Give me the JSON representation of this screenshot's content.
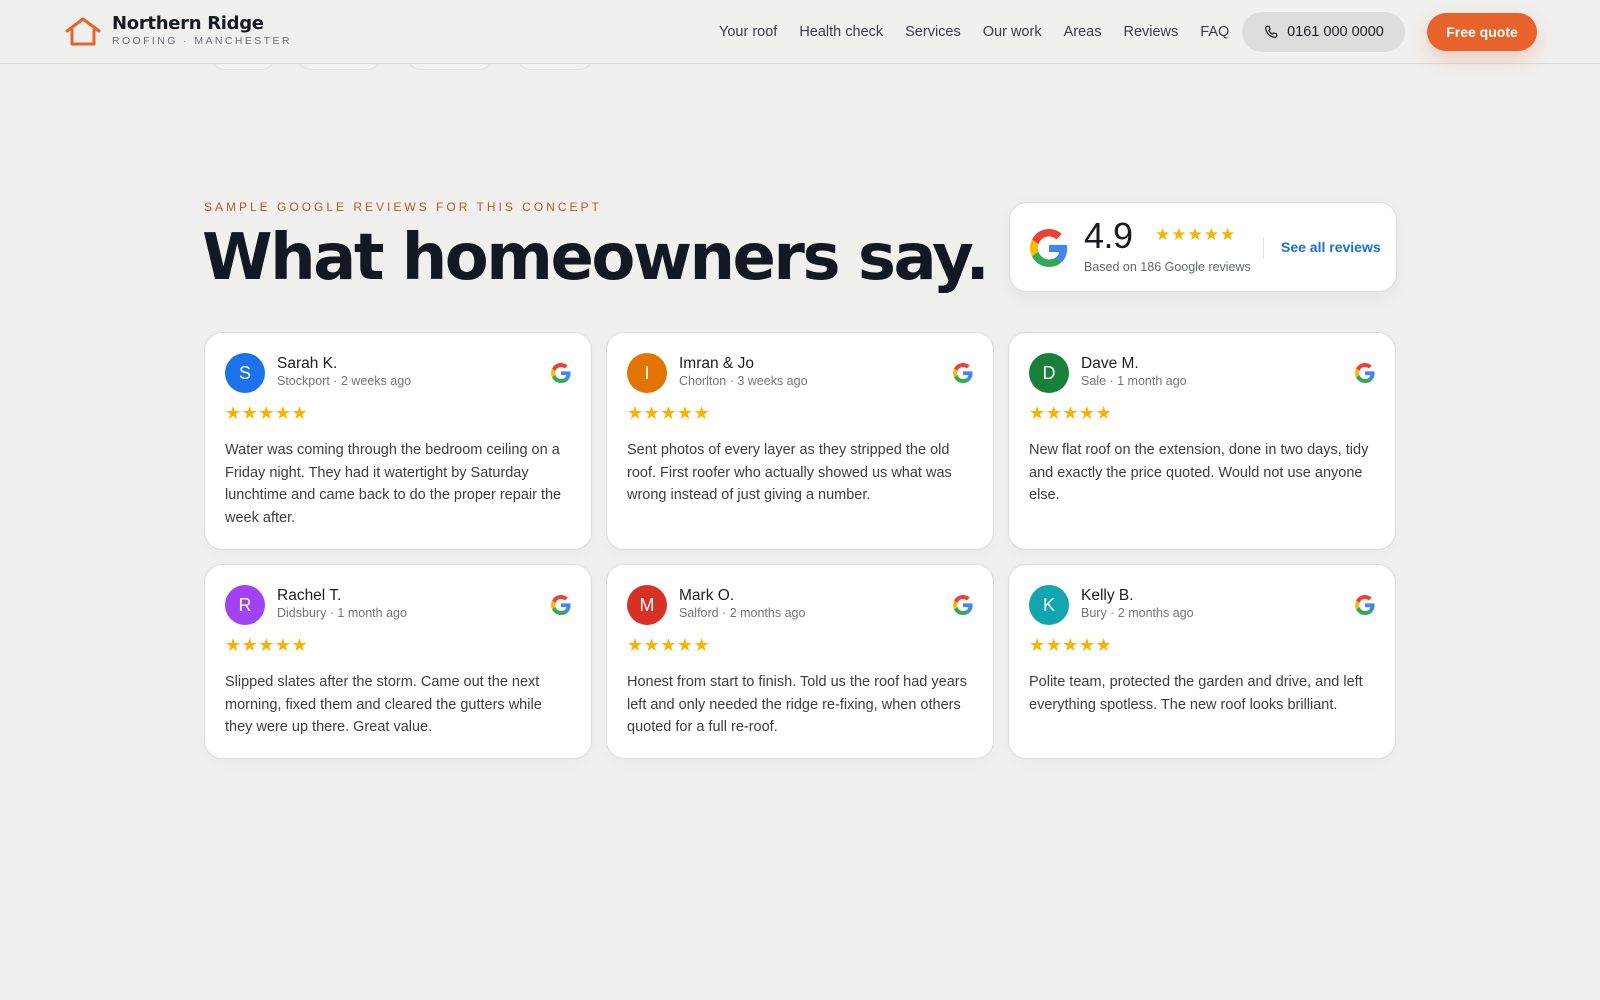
{
  "header": {
    "brand_name": "Northern Ridge",
    "brand_sub": "ROOFING · MANCHESTER",
    "nav": [
      "Your roof",
      "Health check",
      "Services",
      "Our work",
      "Areas",
      "Reviews",
      "FAQ"
    ],
    "phone": "0161 000 0000",
    "cta": "Free quote"
  },
  "colors": {
    "accent": "#e8622c",
    "eyebrow": "#c4552a",
    "stars": "#f4b400",
    "link": "#1b6fd1",
    "background": "#f0f0ee"
  },
  "reviews_section": {
    "eyebrow": "SAMPLE GOOGLE REVIEWS FOR THIS CONCEPT",
    "headline": "What homeowners say.",
    "summary": {
      "score": "4.9",
      "stars": "★★★★★",
      "basis": "Based on 186 Google reviews",
      "link": "See all reviews",
      "icon": "google-g-icon"
    },
    "reviews": [
      {
        "initial": "S",
        "name": "Sarah K.",
        "meta": "Stockport · 2 weeks ago",
        "stars": "★★★★★",
        "rating": 5,
        "avatar_color": "#1a73e8",
        "text": "Water was coming through the bedroom ceiling on a Friday night. They had it watertight by Saturday lunchtime and came back to do the proper repair the week after."
      },
      {
        "initial": "I",
        "name": "Imran & Jo",
        "meta": "Chorlton · 3 weeks ago",
        "stars": "★★★★★",
        "rating": 5,
        "avatar_color": "#e37400",
        "text": "Sent photos of every layer as they stripped the old roof. First roofer who actually showed us what was wrong instead of just giving a number."
      },
      {
        "initial": "D",
        "name": "Dave M.",
        "meta": "Sale · 1 month ago",
        "stars": "★★★★★",
        "rating": 5,
        "avatar_color": "#188038",
        "text": "New flat roof on the extension, done in two days, tidy and exactly the price quoted. Would not use anyone else."
      },
      {
        "initial": "R",
        "name": "Rachel T.",
        "meta": "Didsbury · 1 month ago",
        "stars": "★★★★★",
        "rating": 5,
        "avatar_color": "#a142f4",
        "text": "Slipped slates after the storm. Came out the next morning, fixed them and cleared the gutters while they were up there. Great value."
      },
      {
        "initial": "M",
        "name": "Mark O.",
        "meta": "Salford · 2 months ago",
        "stars": "★★★★★",
        "rating": 5,
        "avatar_color": "#d93025",
        "text": "Honest from start to finish. Told us the roof had years left and only needed the ridge re-fixing, when others quoted for a full re-roof."
      },
      {
        "initial": "K",
        "name": "Kelly B.",
        "meta": "Bury · 2 months ago",
        "stars": "★★★★★",
        "rating": 5,
        "avatar_color": "#12a4af",
        "text": "Polite team, protected the garden and drive, and left everything spotless. The new roof looks brilliant."
      }
    ]
  }
}
